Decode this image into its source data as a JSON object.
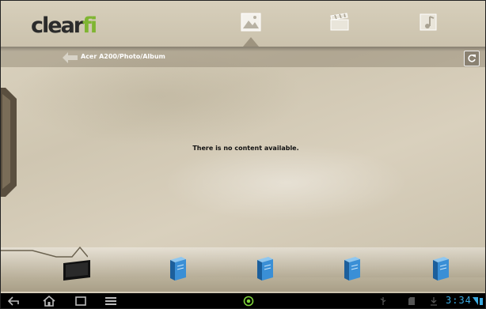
{
  "app": {
    "logo_text_main": "clear",
    "logo_text_accent": "fi"
  },
  "tabs": [
    {
      "icon": "photo-icon"
    },
    {
      "icon": "video-icon"
    },
    {
      "icon": "music-icon"
    }
  ],
  "breadcrumb": {
    "path": "Acer A200/Photo/Album"
  },
  "main": {
    "empty_message": "There is no content available."
  },
  "devices": [
    {
      "icon": "tablet-icon"
    },
    {
      "icon": "server-icon"
    },
    {
      "icon": "server-icon"
    },
    {
      "icon": "server-icon"
    },
    {
      "icon": "server-icon"
    }
  ],
  "status_bar": {
    "time": "3:34"
  },
  "colors": {
    "accent": "#7fb532",
    "clock": "#3aa9e0"
  }
}
